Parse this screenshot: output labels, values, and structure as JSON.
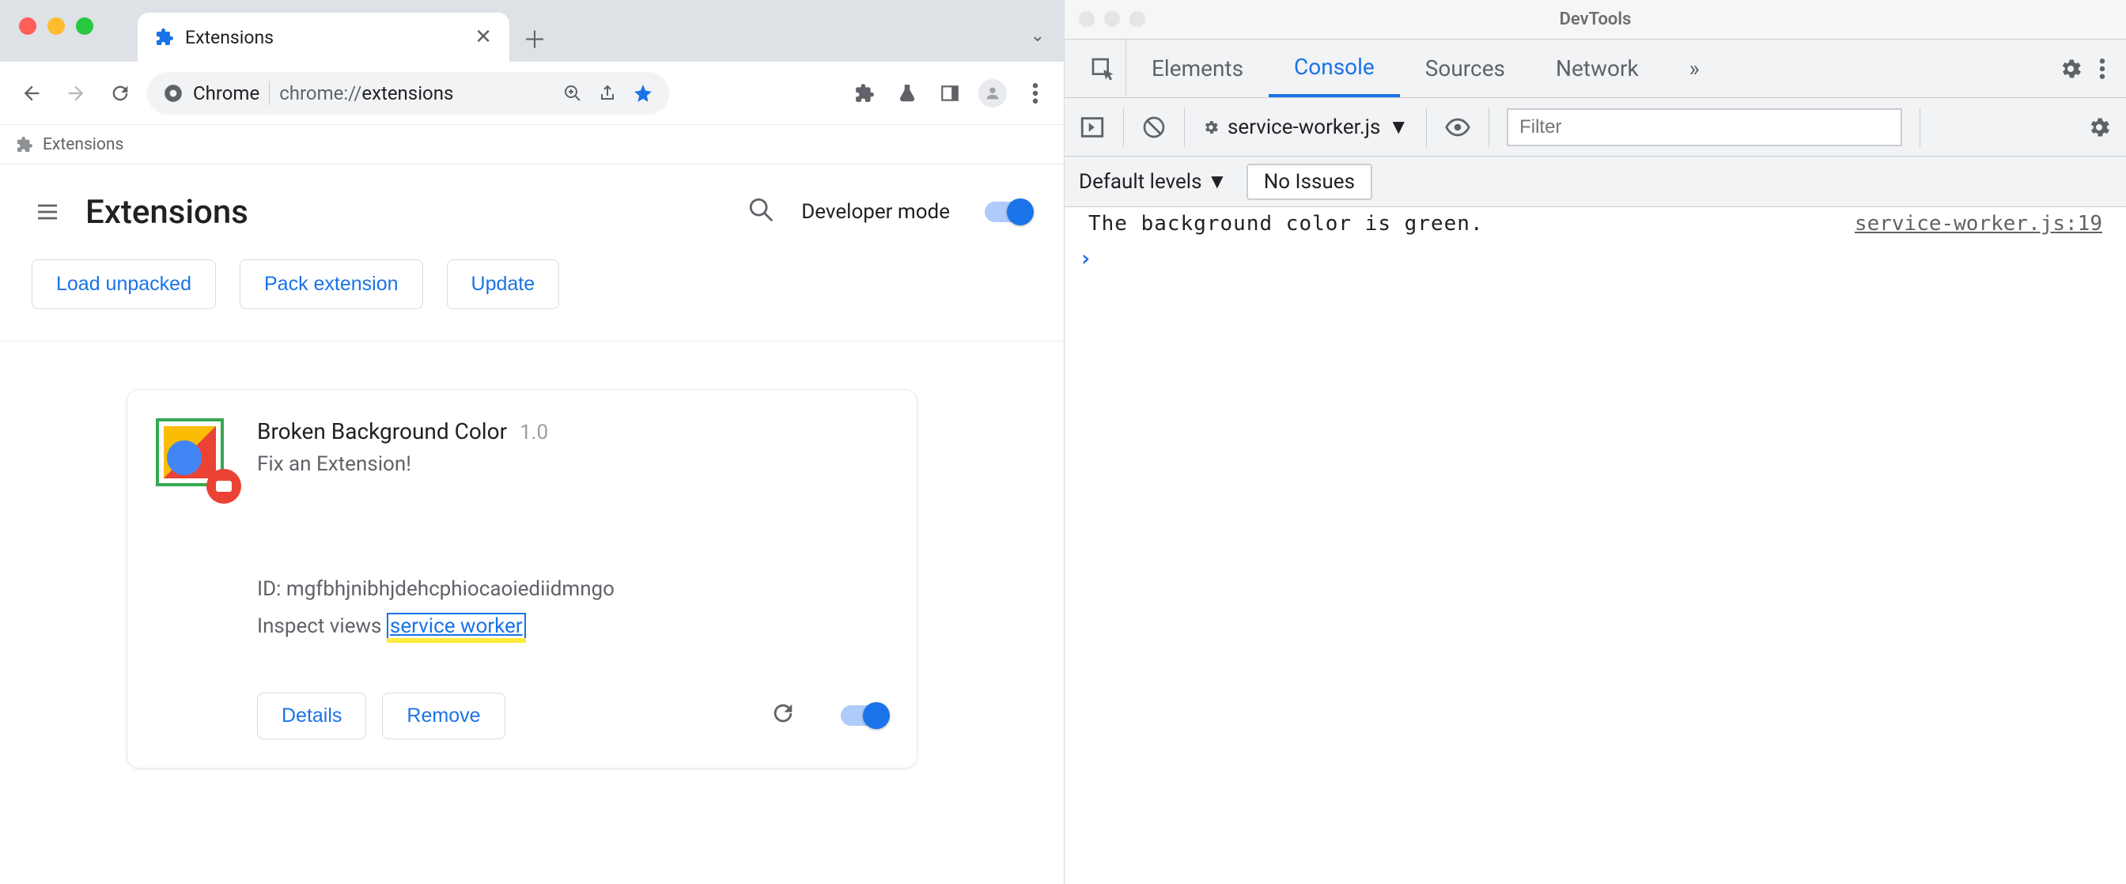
{
  "chrome": {
    "tab": {
      "title": "Extensions"
    },
    "omnibox": {
      "origin": "Chrome",
      "path_prefix": "chrome://",
      "path_bold": "extensions"
    },
    "bookmark": {
      "label": "Extensions"
    },
    "page": {
      "title": "Extensions",
      "dev_mode_label": "Developer mode",
      "actions": {
        "load_unpacked": "Load unpacked",
        "pack_extension": "Pack extension",
        "update": "Update"
      }
    },
    "extension_card": {
      "name": "Broken Background Color",
      "version": "1.0",
      "description": "Fix an Extension!",
      "id_label": "ID: ",
      "id_value": "mgfbhjnibhjdehcphiocaoiediidmngo",
      "inspect_label": "Inspect views ",
      "inspect_link": "service worker",
      "details": "Details",
      "remove": "Remove"
    }
  },
  "devtools": {
    "title": "DevTools",
    "tabs": {
      "elements": "Elements",
      "console": "Console",
      "sources": "Sources",
      "network": "Network"
    },
    "subbar": {
      "context": "service-worker.js",
      "filter_placeholder": "Filter"
    },
    "subbar2": {
      "levels": "Default levels",
      "issues": "No Issues"
    },
    "console": {
      "message": "The background color is green.",
      "source": "service-worker.js:19"
    }
  }
}
